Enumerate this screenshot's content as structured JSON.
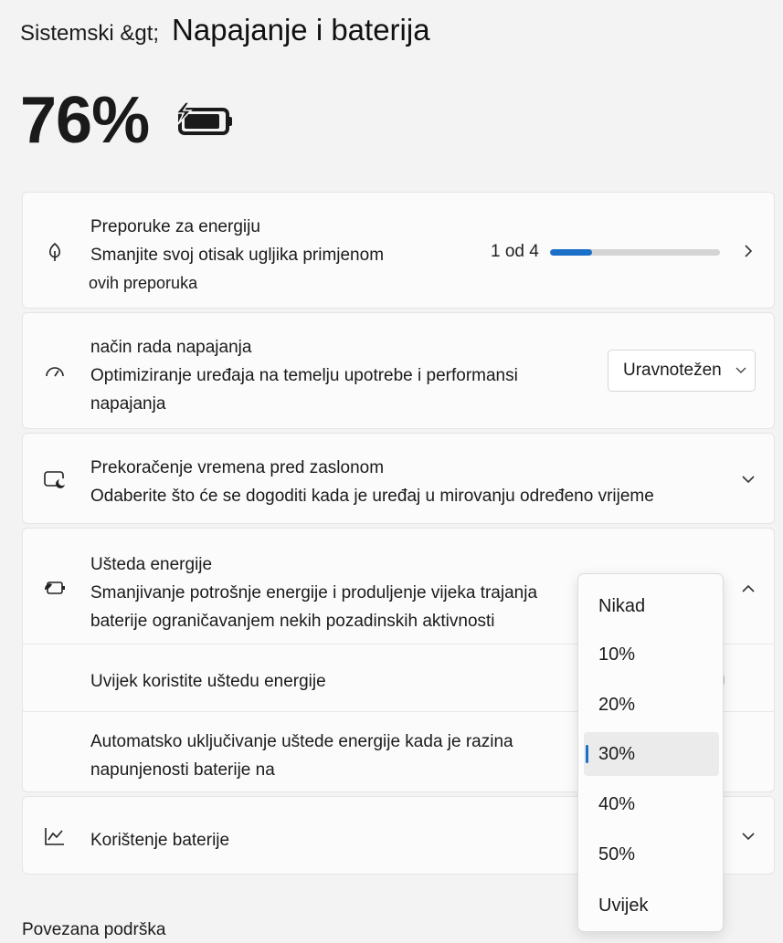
{
  "breadcrumb": {
    "parent": "Sistemski &gt;",
    "current": "Napajanje i baterija"
  },
  "battery": {
    "percent": "76%",
    "icon": "battery-charging-icon"
  },
  "recommendations": {
    "title": "Preporuke za energiju",
    "desc1": "Smanjite svoj otisak ugljika primjenom",
    "desc2": "ovih preporuka",
    "progress_label": "1 od 4",
    "progress_value": 0.25,
    "icon": "leaf-icon"
  },
  "power_mode": {
    "title": "način rada napajanja",
    "desc1": "Optimiziranje uređaja na temelju upotrebe i performansi",
    "desc2": "napajanja",
    "selected": "Uravnotežen",
    "icon": "gauge-icon"
  },
  "screen_timeout": {
    "title": "Prekoračenje vremena pred zaslonom",
    "desc": "Odaberite što će se dogoditi kada je uređaj u mirovanju određeno vrijeme",
    "icon": "screen-sleep-icon"
  },
  "energy_saver": {
    "title": "Ušteda energije",
    "desc1": "Smanjivanje potrošnje energije i produljenje vijeka trajanja",
    "desc2": "baterije ograničavanjem nekih pozadinskih aktivnosti",
    "always_label": "Uvijek koristite uštedu energije",
    "auto_line1": "Automatsko uključivanje uštede energije kada je razina",
    "auto_line2": "napunjenosti baterije na",
    "icon": "battery-saver-icon"
  },
  "battery_usage": {
    "title": "Korištenje baterije",
    "icon": "chart-icon"
  },
  "dropdown_options": [
    {
      "label": "Nikad"
    },
    {
      "label": "10%"
    },
    {
      "label": "20%"
    },
    {
      "label": "30%"
    },
    {
      "label": "40%"
    },
    {
      "label": "50%"
    },
    {
      "label": "Uvijek"
    }
  ],
  "dropdown_selected_index": 3,
  "related_support": "Povezana podrška",
  "colors": {
    "accent": "#1a6fc9",
    "background": "#f3f3f3",
    "card": "#fbfbfb"
  }
}
